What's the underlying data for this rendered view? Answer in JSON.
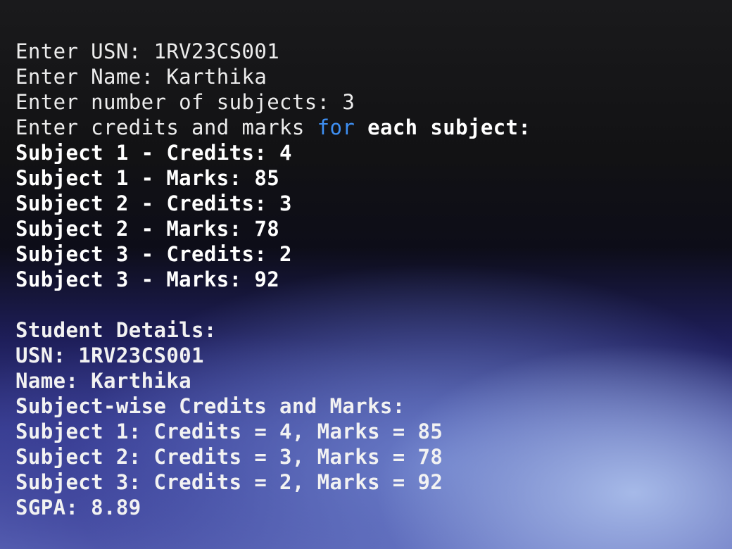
{
  "terminal": {
    "input_lines": [
      "Enter USN: 1RV23CS001",
      "Enter Name: Karthika",
      "Enter number of subjects: 3"
    ],
    "prompt_line": {
      "before": "Enter credits and marks ",
      "keyword": "for",
      "after": " each subject:"
    },
    "subject_inputs": [
      "Subject 1 - Credits: 4",
      "Subject 1 - Marks: 85",
      "Subject 2 - Credits: 3",
      "Subject 2 - Marks: 78",
      "Subject 3 - Credits: 2",
      "Subject 3 - Marks: 92"
    ],
    "output": {
      "heading": "Student Details:",
      "usn": "USN: 1RV23CS001",
      "name": "Name: Karthika",
      "subheading": "Subject-wise Credits and Marks:",
      "subjects": [
        "Subject 1: Credits = 4, Marks = 85",
        "Subject 2: Credits = 3, Marks = 78",
        "Subject 3: Credits = 2, Marks = 92"
      ],
      "sgpa": "SGPA: 8.89"
    }
  },
  "colors": {
    "keyword": "#3e8ff2",
    "text": "#ececec"
  }
}
